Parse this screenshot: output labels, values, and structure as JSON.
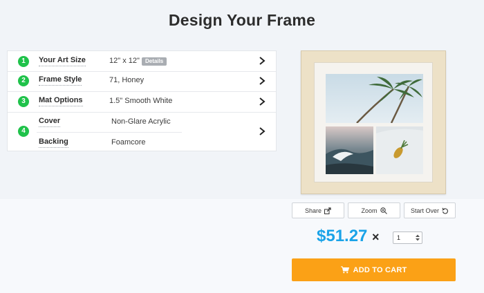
{
  "title": "Design Your Frame",
  "options": [
    {
      "number": "1",
      "label": "Your Art Size",
      "value": "12\" x 12\"",
      "badge": "Details"
    },
    {
      "number": "2",
      "label": "Frame Style",
      "value": "71, Honey"
    },
    {
      "number": "3",
      "label": "Mat Options",
      "value": "1.5\" Smooth White"
    },
    {
      "number": "4",
      "sub_items": [
        {
          "label": "Cover",
          "value": "Non-Glare Acrylic"
        },
        {
          "label": "Backing",
          "value": "Foamcore"
        }
      ]
    }
  ],
  "preview_tools": {
    "share": "Share",
    "zoom": "Zoom",
    "start_over": "Start Over"
  },
  "price": "$51.27",
  "times_symbol": "×",
  "quantity": "1",
  "add_to_cart": "ADD TO CART",
  "colors": {
    "accent_green": "#1fc24a",
    "price_blue": "#1aa3e8",
    "cart_orange": "#fba116"
  },
  "icons": [
    "chevron-right-icon",
    "share-icon",
    "zoom-in-icon",
    "undo-icon",
    "cart-icon"
  ]
}
